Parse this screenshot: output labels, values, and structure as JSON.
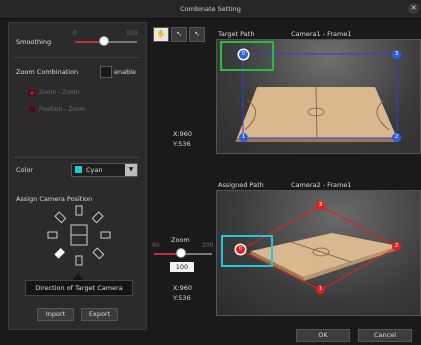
{
  "window": {
    "title": "Combinate Setting",
    "close_icon": "close-icon"
  },
  "smoothing": {
    "label": "Smoothing",
    "min": "0",
    "max": "100",
    "value": 55
  },
  "zoom_combination": {
    "label": "Zoom Combination",
    "enable_label": "enable",
    "enabled": false,
    "options": [
      "Zoom - Zoom",
      "Position - Zoom"
    ]
  },
  "color": {
    "label": "Color",
    "value": "Cyan",
    "swatch": "#20c8d8"
  },
  "assign": {
    "label": "Assign Camera Position",
    "tooltip": "Direction of Target Camera"
  },
  "footer_left": {
    "import": "Inport",
    "export": "Export"
  },
  "tools": [
    "hand-icon",
    "plus-pointer-icon",
    "minus-pointer-icon"
  ],
  "target": {
    "label": "Target Path",
    "camera": "Camera1 - Frame1",
    "x_coord": "X:960",
    "y_coord": "Y:536",
    "points": [
      "0",
      "1",
      "2",
      "3"
    ],
    "accent": "#3a3adc"
  },
  "assigned": {
    "label": "Assigned Path",
    "camera": "Camera2 - Frame1",
    "x_coord": "X:960",
    "y_coord": "Y:536",
    "points": [
      "0",
      "1",
      "2",
      "3"
    ],
    "accent": "#e02020"
  },
  "zoom": {
    "label": "Zoom",
    "min": "90",
    "max": "200",
    "value": "100"
  },
  "buttons": {
    "ok": "OK",
    "cancel": "Cancel"
  }
}
